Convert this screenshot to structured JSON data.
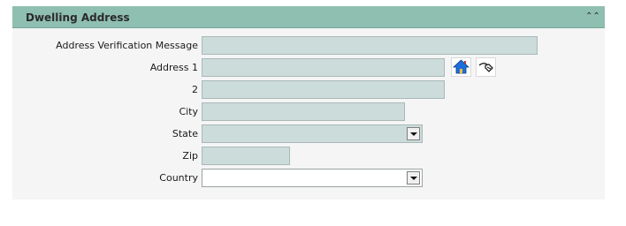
{
  "panel": {
    "title": "Dwelling Address",
    "collapse_icon": "double-chevron-up-icon"
  },
  "form": {
    "address_verification_message": {
      "label": "Address Verification Message",
      "value": ""
    },
    "address1": {
      "label": "Address 1",
      "value": ""
    },
    "address2": {
      "label": "2",
      "value": ""
    },
    "city": {
      "label": "City",
      "value": ""
    },
    "state": {
      "label": "State",
      "value": ""
    },
    "zip": {
      "label": "Zip",
      "value": ""
    },
    "country": {
      "label": "Country",
      "value": ""
    }
  },
  "icons": {
    "home": "house-icon",
    "verify": "address-lookup-icon"
  },
  "colors": {
    "header": "#8fbfb0",
    "field": "#ccdcdb",
    "panel": "#f5f5f5"
  }
}
